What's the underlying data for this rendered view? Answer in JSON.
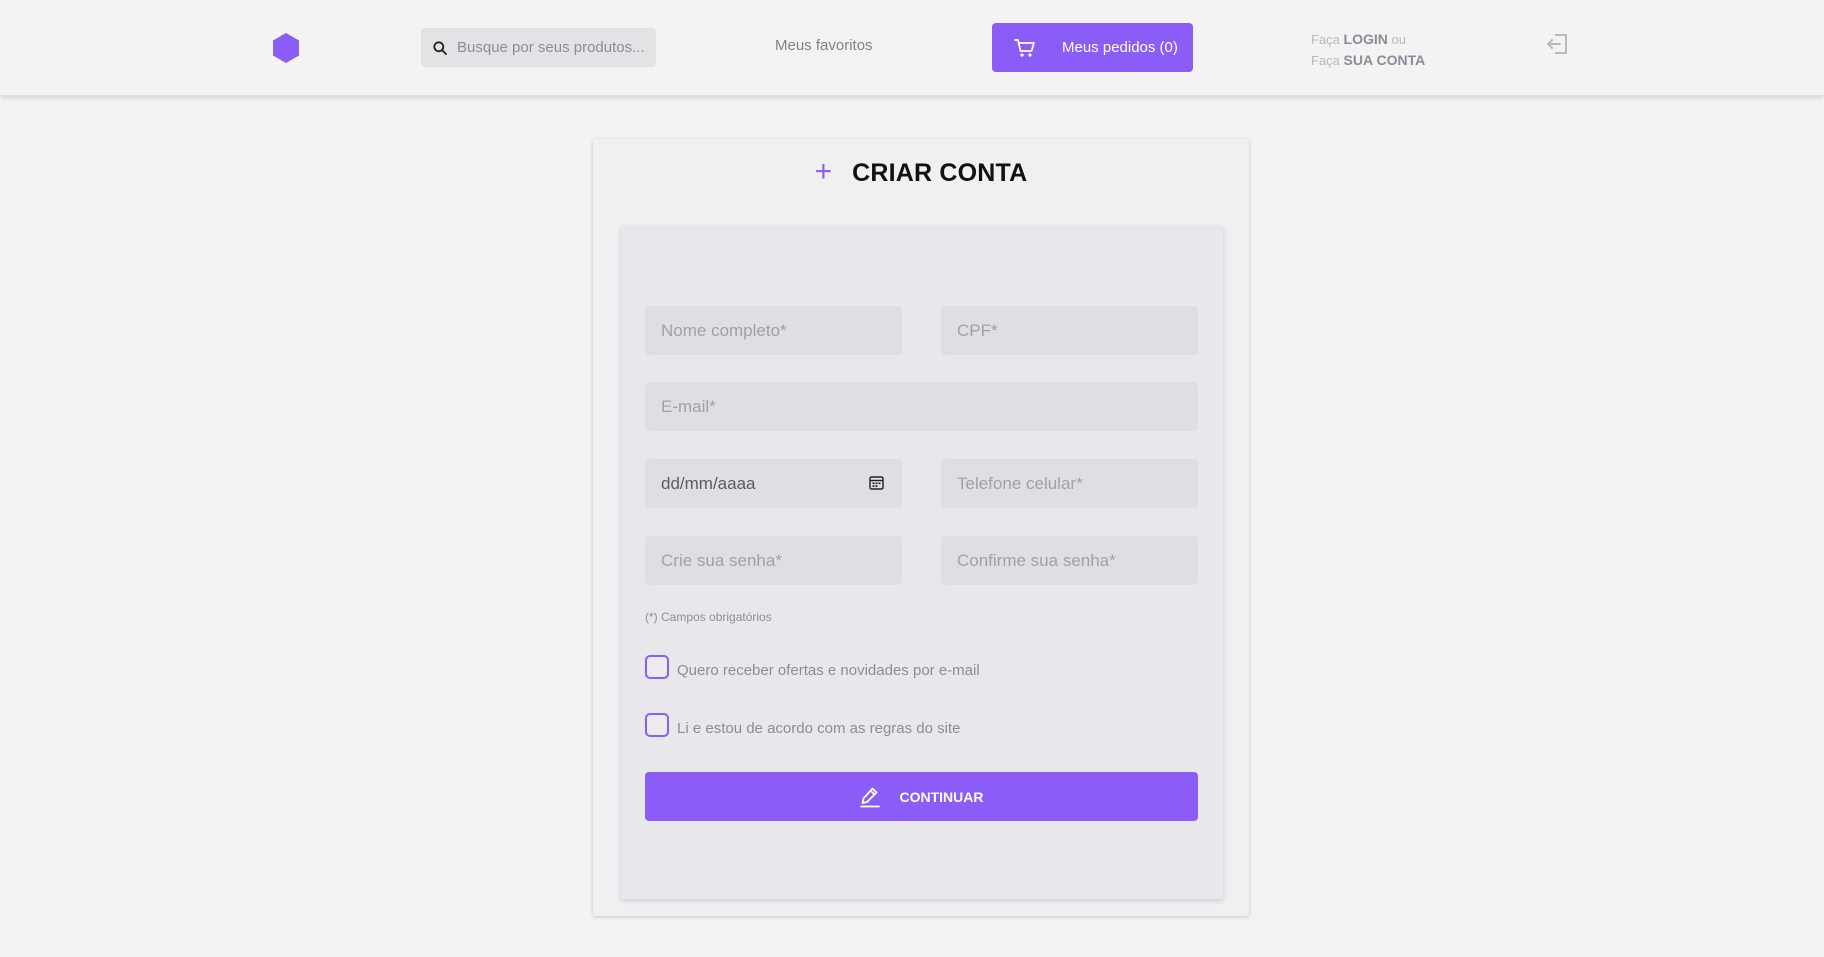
{
  "header": {
    "search_placeholder": "Busque por seus produtos...",
    "favorites_label": "Meus favoritos",
    "orders_label": "Meus pedidos (0)",
    "auth_line1_prefix": "Faça",
    "auth_line1_strong": "LOGIN",
    "auth_line1_suffix": "ou",
    "auth_line2_prefix": "Faça",
    "auth_line2_strong": "SUA CONTA",
    "icons": {
      "logo": "hexagon-logo-icon",
      "search": "search-icon",
      "cart": "cart-icon",
      "logout": "logout-icon"
    }
  },
  "form": {
    "title": "CRIAR CONTA",
    "title_icon": "plus-icon",
    "name_placeholder": "Nome completo*",
    "cpf_placeholder": "CPF*",
    "email_placeholder": "E-mail*",
    "date_value": "dd/mm/aaaa",
    "date_icon": "calendar-icon",
    "phone_placeholder": "Telefone celular*",
    "password_placeholder": "Crie sua senha*",
    "confirm_password_placeholder": "Confirme sua senha*",
    "required_note": "(*) Campos obrigatórios",
    "offers_label": "Quero receber ofertas e novidades por e-mail",
    "offers_checked": false,
    "terms_label": "Li e estou de acordo com as regras do site",
    "terms_checked": false,
    "continue_label": "CONTINUAR",
    "continue_icon": "pencil-icon"
  },
  "colors": {
    "accent": "#8b5cf6",
    "background": "#f3f3f4",
    "field": "#dfdfe3"
  }
}
